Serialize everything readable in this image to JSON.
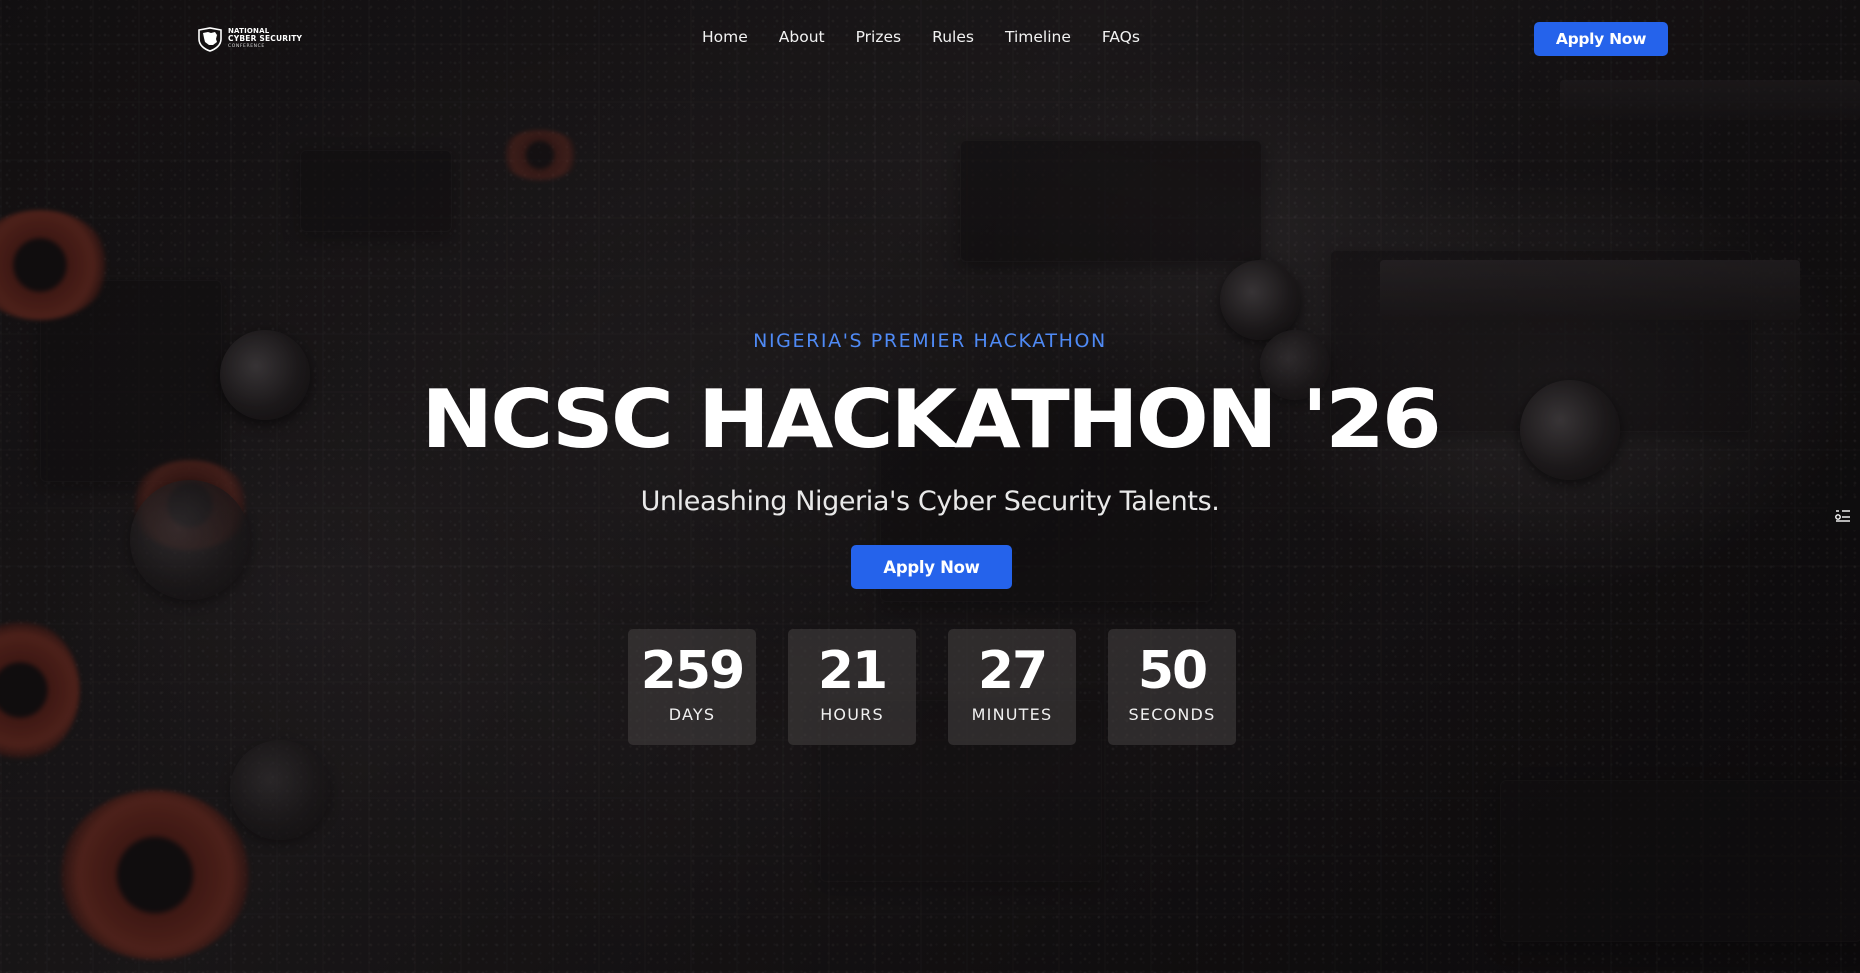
{
  "logo": {
    "line1": "NATIONAL",
    "line2": "CYBER SECURITY",
    "line3": "CONFERENCE"
  },
  "nav": {
    "items": [
      {
        "label": "Home"
      },
      {
        "label": "About"
      },
      {
        "label": "Prizes"
      },
      {
        "label": "Rules"
      },
      {
        "label": "Timeline"
      },
      {
        "label": "FAQs"
      }
    ],
    "apply_label": "Apply Now"
  },
  "hero": {
    "eyebrow": "NIGERIA'S PREMIER HACKATHON",
    "title": "NCSC HACKATHON '26",
    "subtitle": "Unleashing Nigeria's Cyber Security Talents.",
    "apply_label": "Apply Now"
  },
  "countdown": [
    {
      "value": "259",
      "label": "DAYS"
    },
    {
      "value": "21",
      "label": "HOURS"
    },
    {
      "value": "27",
      "label": "MINUTES"
    },
    {
      "value": "50",
      "label": "SECONDS"
    }
  ],
  "colors": {
    "accent": "#2563eb",
    "eyebrow": "#4f8af5",
    "background": "#141213"
  },
  "icons": {
    "logo": "shield-map-icon",
    "side_widget": "accessibility-settings-icon"
  }
}
